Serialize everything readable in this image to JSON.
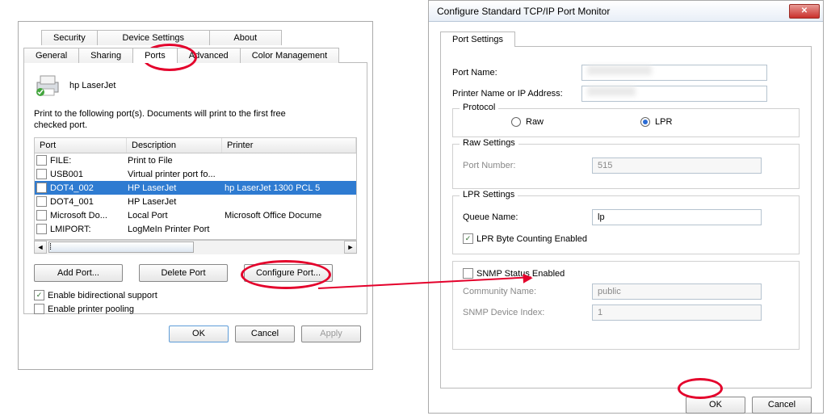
{
  "dialog1": {
    "tabsTop": [
      "Security",
      "Device Settings",
      "About"
    ],
    "tabsBottom": [
      "General",
      "Sharing",
      "Ports",
      "Advanced",
      "Color Management"
    ],
    "activeTab": "Ports",
    "printerName": "hp LaserJet",
    "intro": "Print to the following port(s). Documents will print to the first free\nchecked port.",
    "columns": {
      "port": "Port",
      "desc": "Description",
      "printer": "Printer"
    },
    "rows": [
      {
        "checked": false,
        "port": "FILE:",
        "desc": "Print to File",
        "printer": ""
      },
      {
        "checked": false,
        "port": "USB001",
        "desc": "Virtual printer port fo...",
        "printer": ""
      },
      {
        "checked": true,
        "port": "DOT4_002",
        "desc": "HP LaserJet",
        "printer": "hp LaserJet 1300 PCL 5",
        "selected": true
      },
      {
        "checked": false,
        "port": "DOT4_001",
        "desc": "HP LaserJet",
        "printer": ""
      },
      {
        "checked": false,
        "port": "Microsoft Do...",
        "desc": "Local Port",
        "printer": "Microsoft Office Docume"
      },
      {
        "checked": false,
        "port": "LMIPORT:",
        "desc": "LogMeIn Printer Port",
        "printer": ""
      }
    ],
    "btnAdd": "Add Port...",
    "btnDel": "Delete Port",
    "btnCfg": "Configure Port...",
    "chkBidir": {
      "checked": true,
      "label": "Enable bidirectional support"
    },
    "chkPool": {
      "checked": false,
      "label": "Enable printer pooling"
    },
    "ok": "OK",
    "cancel": "Cancel",
    "apply": "Apply"
  },
  "dialog2": {
    "title": "Configure Standard TCP/IP Port Monitor",
    "tab": "Port Settings",
    "portNameLabel": "Port Name:",
    "printerAddrLabel": "Printer Name or IP Address:",
    "protocol": {
      "label": "Protocol",
      "raw": "Raw",
      "lpr": "LPR",
      "selected": "LPR"
    },
    "rawSettings": {
      "label": "Raw Settings",
      "portNumLabel": "Port Number:",
      "portNum": "515"
    },
    "lprSettings": {
      "label": "LPR Settings",
      "queueLabel": "Queue Name:",
      "queue": "lp",
      "byteCount": {
        "checked": true,
        "label": "LPR Byte Counting Enabled"
      }
    },
    "snmp": {
      "checked": false,
      "label": "SNMP Status Enabled",
      "communityLabel": "Community Name:",
      "community": "public",
      "indexLabel": "SNMP Device Index:",
      "index": "1"
    },
    "ok": "OK",
    "cancel": "Cancel"
  }
}
